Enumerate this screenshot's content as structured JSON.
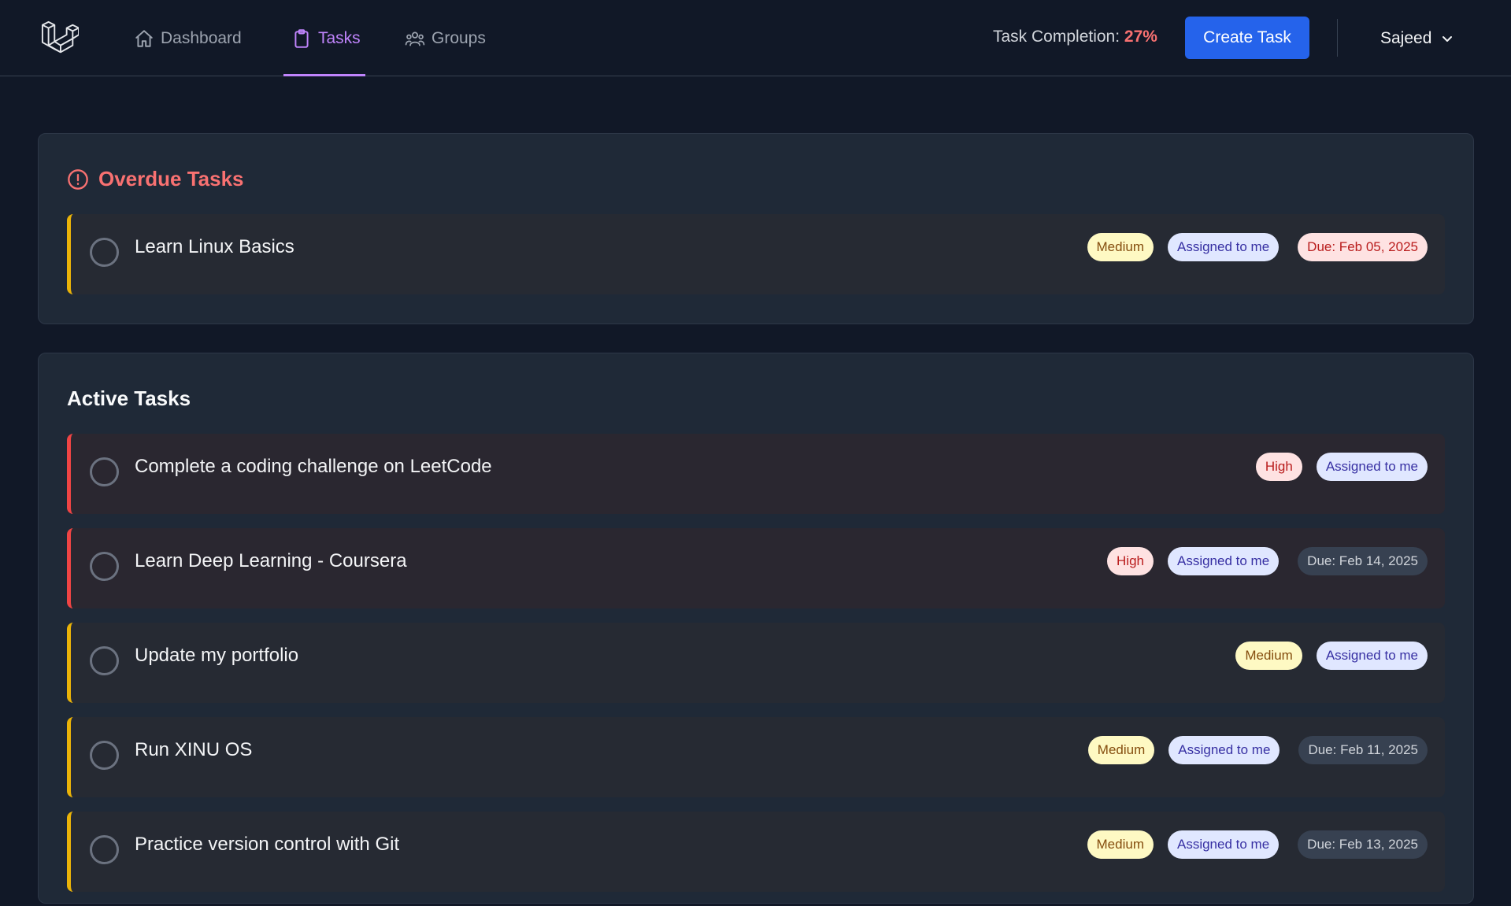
{
  "nav": {
    "items": [
      {
        "label": "Dashboard",
        "icon": "home-icon",
        "active": false
      },
      {
        "label": "Tasks",
        "icon": "clipboard-icon",
        "active": true
      },
      {
        "label": "Groups",
        "icon": "users-icon",
        "active": false
      }
    ],
    "completion_label": "Task Completion:",
    "completion_value": "27%",
    "create_button": "Create Task",
    "user_name": "Sajeed"
  },
  "overdue": {
    "title": "Overdue Tasks",
    "tasks": [
      {
        "title": "Learn Linux Basics",
        "priority": "Medium",
        "assigned": "Assigned to me",
        "due": "Due: Feb 05, 2025"
      }
    ]
  },
  "active": {
    "title": "Active Tasks",
    "tasks": [
      {
        "title": "Complete a coding challenge on LeetCode",
        "priority": "High",
        "assigned": "Assigned to me",
        "due": ""
      },
      {
        "title": "Learn Deep Learning - Coursera",
        "priority": "High",
        "assigned": "Assigned to me",
        "due": "Due: Feb 14, 2025"
      },
      {
        "title": "Update my portfolio",
        "priority": "Medium",
        "assigned": "Assigned to me",
        "due": ""
      },
      {
        "title": "Run XINU OS",
        "priority": "Medium",
        "assigned": "Assigned to me",
        "due": "Due: Feb 11, 2025"
      },
      {
        "title": "Practice version control with Git",
        "priority": "Medium",
        "assigned": "Assigned to me",
        "due": "Due: Feb 13, 2025"
      }
    ]
  },
  "colors": {
    "accent": "#c084fc",
    "primary_button": "#2563eb",
    "overdue": "#f87171",
    "priority_high_border": "#ef4444",
    "priority_medium_border": "#eab308"
  }
}
